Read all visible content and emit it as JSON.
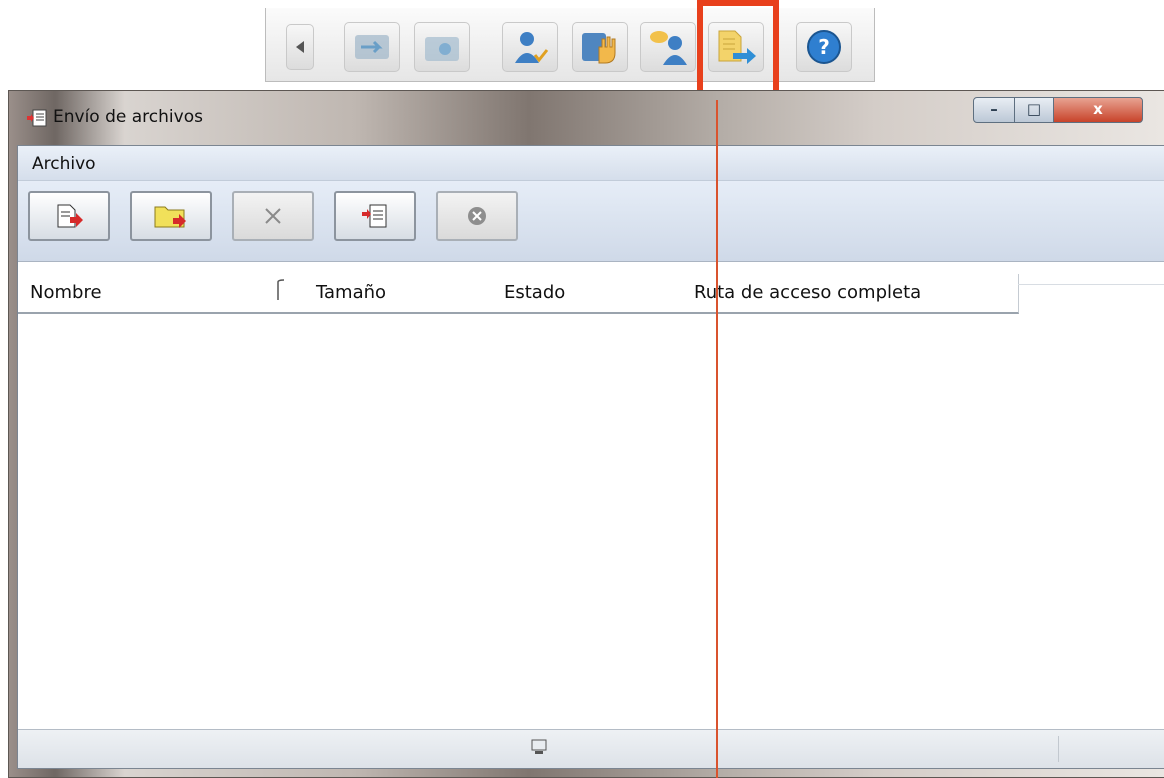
{
  "top_toolbar": {
    "buttons": [
      {
        "icon": "back-arrow-icon",
        "highlighted": false
      },
      {
        "icon": "share-screen-icon",
        "highlighted": false
      },
      {
        "icon": "remote-view-icon",
        "highlighted": false
      },
      {
        "icon": "user-check-icon",
        "highlighted": false
      },
      {
        "icon": "raise-hand-icon",
        "highlighted": false
      },
      {
        "icon": "chat-users-icon",
        "highlighted": false
      },
      {
        "icon": "send-files-icon",
        "highlighted": true
      },
      {
        "icon": "help-icon",
        "highlighted": false
      }
    ],
    "highlight_color": "#e8401c"
  },
  "window": {
    "title": "Envío de archivos",
    "controls": [
      "minimize",
      "maximize",
      "close"
    ]
  },
  "menu": {
    "items": [
      "Archivo"
    ]
  },
  "file_toolbar": {
    "buttons": [
      {
        "icon": "add-file-icon",
        "enabled": true
      },
      {
        "icon": "add-folder-icon",
        "enabled": true
      },
      {
        "icon": "remove-icon",
        "enabled": false
      },
      {
        "icon": "send-list-icon",
        "enabled": true
      },
      {
        "icon": "cancel-icon",
        "enabled": false
      }
    ]
  },
  "list": {
    "columns": [
      "Nombre",
      "Tamaño",
      "Estado",
      "Ruta de acceso completa"
    ],
    "rows": []
  },
  "colors": {
    "accent": "#e8401c",
    "menubar": "#dfe6f1"
  }
}
